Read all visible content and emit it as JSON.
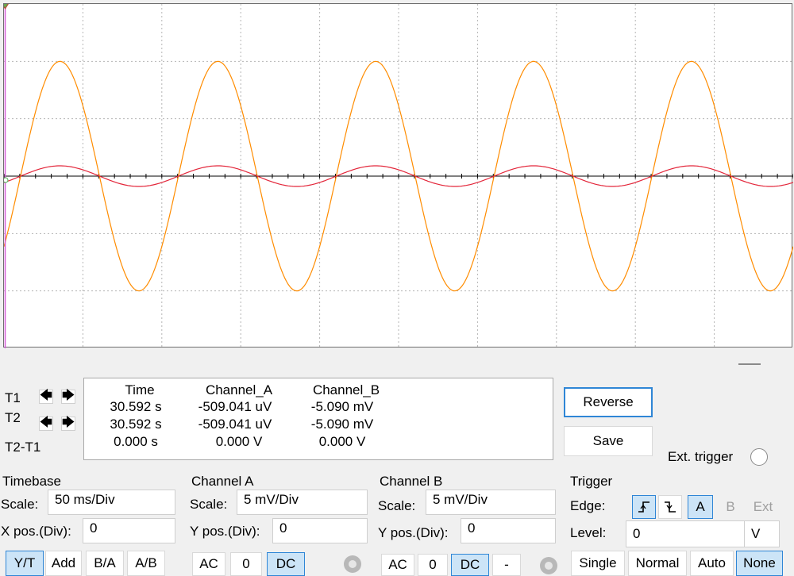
{
  "scope": {
    "grid_divisions": {
      "x": 10,
      "y": 6
    },
    "channel_a_color": "#ff8c00",
    "channel_b_color": "#e3263a",
    "cursor_color": "#d45cd8",
    "channel_a_wave": {
      "periods_visible": 5,
      "amplitude_div": 2.0,
      "start_phase": "falling-below-zero"
    },
    "channel_b_wave": {
      "periods_visible": 5,
      "amplitude_div": 0.18
    }
  },
  "cursors": {
    "t1_label": "T1",
    "t2_label": "T2",
    "diff_label": "T2-T1",
    "left_arrow": "🡄",
    "right_arrow": "🡆"
  },
  "readout": {
    "headers": [
      "Time",
      "Channel_A",
      "Channel_B"
    ],
    "rows": [
      [
        "30.592 s",
        "-509.041 uV",
        "-5.090 mV"
      ],
      [
        "30.592 s",
        "-509.041 uV",
        "-5.090 mV"
      ],
      [
        "0.000 s",
        "0.000 V",
        "0.000 V"
      ]
    ]
  },
  "buttons": {
    "reverse": "Reverse",
    "save": "Save",
    "ext_trigger": "Ext. trigger"
  },
  "timebase": {
    "title": "Timebase",
    "scale_label": "Scale:",
    "scale_value": "50 ms/Div",
    "xpos_label": "X pos.(Div):",
    "xpos_value": "0",
    "modes": [
      "Y/T",
      "Add",
      "B/A",
      "A/B"
    ],
    "selected_mode": "Y/T"
  },
  "channel_a": {
    "title": "Channel A",
    "scale_label": "Scale:",
    "scale_value": "5 mV/Div",
    "ypos_label": "Y pos.(Div):",
    "ypos_value": "0",
    "coupling": [
      "AC",
      "0",
      "DC"
    ],
    "selected": "DC"
  },
  "channel_b": {
    "title": "Channel B",
    "scale_label": "Scale:",
    "scale_value": "5 mV/Div",
    "ypos_label": "Y pos.(Div):",
    "ypos_value": "0",
    "coupling": [
      "AC",
      "0",
      "DC",
      "-"
    ],
    "selected": "DC"
  },
  "trigger": {
    "title": "Trigger",
    "edge_label": "Edge:",
    "level_label": "Level:",
    "level_value": "0",
    "level_unit": "V",
    "sources": [
      "A",
      "B",
      "Ext"
    ],
    "selected_source": "A",
    "modes": [
      "Single",
      "Normal",
      "Auto",
      "None"
    ],
    "selected_mode": "None"
  }
}
